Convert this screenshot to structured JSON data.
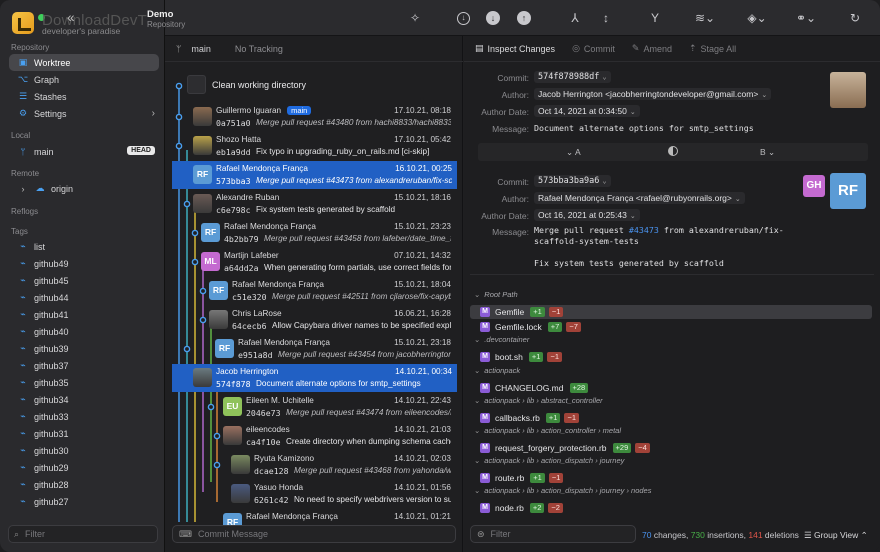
{
  "app": {
    "title": "DownloadDevT",
    "subtitle": "developer's paradise"
  },
  "repo": {
    "title": "Demo",
    "subtitle": "Repository"
  },
  "sidebar": {
    "repository_label": "Repository",
    "repo_items": [
      "Worktree",
      "Graph",
      "Stashes",
      "Settings"
    ],
    "local_label": "Local",
    "local_branch": "main",
    "head_badge": "HEAD",
    "remote_label": "Remote",
    "remote_item": "origin",
    "reflogs_label": "Reflogs",
    "tags_label": "Tags",
    "tags": [
      "list",
      "github49",
      "github45",
      "github44",
      "github41",
      "github40",
      "github39",
      "github37",
      "github35",
      "github34",
      "github33",
      "github31",
      "github30",
      "github29",
      "github28",
      "github27"
    ],
    "filter_placeholder": "Filter"
  },
  "branch_bar": {
    "branch": "main",
    "tracking": "No Tracking"
  },
  "worktree": {
    "clean": "Clean working directory"
  },
  "commits": [
    {
      "author": "Guillermo Iguaran",
      "tag": "main",
      "date": "17.10.21, 08:18",
      "sha": "0a751a0",
      "msg": "Merge pull request #43480 from hachi8833/hachi8833-...",
      "merge": true,
      "avatar": "photo",
      "color": "#8a6a50"
    },
    {
      "author": "Shozo Hatta",
      "date": "17.10.21, 05:42",
      "sha": "eb1a9dd",
      "msg": "Fix typo in upgrading_ruby_on_rails.md [ci-skip]",
      "merge": false,
      "avatar": "photo",
      "color": "#b9a24a"
    },
    {
      "author": "Rafael Mendonça França",
      "date": "16.10.21, 00:25",
      "sha": "573bba3",
      "msg": "Merge pull request #43473 from alexandreruban/fix-sca...",
      "merge": true,
      "avatar": "RF",
      "color": "#5b9bd5",
      "selected": true
    },
    {
      "author": "Alexandre Ruban",
      "date": "15.10.21, 18:16",
      "sha": "c6e798c",
      "msg": "Fix system tests generated by scaffold",
      "merge": false,
      "avatar": "photo",
      "color": "#6a5a55"
    },
    {
      "author": "Rafael Mendonça França",
      "date": "15.10.21, 23:23",
      "sha": "4b2bb79",
      "msg": "Merge pull request #43458 from lafeber/date_time_fi...",
      "merge": true,
      "avatar": "RF",
      "color": "#5b9bd5"
    },
    {
      "author": "Martijn Lafeber",
      "date": "07.10.21, 14:32",
      "sha": "a64dd2a",
      "msg": "When generating form partials, use correct fields for d...",
      "merge": false,
      "avatar": "ML",
      "color": "#c46ad0"
    },
    {
      "author": "Rafael Mendonça França",
      "date": "15.10.21, 18:04",
      "sha": "c51e320",
      "msg": "Merge pull request #42511 from cjlarose/fix-capybar...",
      "merge": true,
      "avatar": "RF",
      "color": "#5b9bd5"
    },
    {
      "author": "Chris LaRose",
      "date": "16.06.21, 16:28",
      "sha": "64cecb6",
      "msg": "Allow Capybara driver names to be specified explicitly",
      "merge": false,
      "avatar": "photo",
      "color": "#777"
    },
    {
      "author": "Rafael Mendonça França",
      "date": "15.10.21, 23:18",
      "sha": "e951a8d",
      "msg": "Merge pull request #43454 from jacobherrington/a...",
      "merge": true,
      "avatar": "RF",
      "color": "#5b9bd5"
    },
    {
      "author": "Jacob Herrington",
      "date": "14.10.21, 00:34",
      "sha": "574f878",
      "msg": "Document alternate options for smtp_settings",
      "merge": false,
      "avatar": "photo",
      "color": "#6a7a80",
      "selected": true
    },
    {
      "author": "Eileen M. Uchitelle",
      "date": "14.10.21, 22:43",
      "sha": "2046e73",
      "msg": "Merge pull request #43474 from eileencodes/ma...",
      "merge": true,
      "avatar": "EU",
      "color": "#8fc25a"
    },
    {
      "author": "eileencodes",
      "date": "14.10.21, 21:03",
      "sha": "ca4f10e",
      "msg": "Create directory when dumping schema cache",
      "merge": false,
      "avatar": "photo",
      "color": "#9a7060"
    },
    {
      "author": "Ryuta Kamizono",
      "date": "14.10.21, 02:03",
      "sha": "dcae128",
      "msg": "Merge pull request #43468 from yahonda/webdri...",
      "merge": true,
      "avatar": "photo",
      "color": "#7a8a60"
    },
    {
      "author": "Yasuo Honda",
      "date": "14.10.21, 01:56",
      "sha": "6261c42",
      "msg": "No need to specify webdrivers version to support sel...",
      "merge": false,
      "avatar": "photo",
      "color": "#4a5a80"
    },
    {
      "author": "Rafael Mendonça França",
      "date": "14.10.21, 01:21",
      "sha": "",
      "msg": "",
      "merge": true,
      "avatar": "RF",
      "color": "#5b9bd5"
    }
  ],
  "commit_message_placeholder": "Commit Message",
  "detail_tabs": [
    "Inspect Changes",
    "Commit",
    "Amend",
    "Stage All"
  ],
  "detail": {
    "labels": {
      "commit": "Commit:",
      "author": "Author:",
      "date": "Author Date:",
      "message": "Message:"
    },
    "a": {
      "commit": "574f878988df",
      "author": "Jacob Herrington <jacobherringtondeveloper@gmail.com>",
      "date": "Oct 14, 2021 at 0:34:50",
      "message": "Document alternate options for smtp_settings"
    },
    "ab": {
      "a": "A",
      "b": "B"
    },
    "b": {
      "commit": "573bba3ba9a6",
      "author": "Rafael Mendonça França <rafael@rubyonrails.org>",
      "date": "Oct 16, 2021 at 0:25:43",
      "message_line1_pre": "Merge pull request ",
      "message_link": "#43473",
      "message_line1_post": " from alexandreruban/fix-",
      "message_line2": "scaffold-system-tests",
      "message_line3": "Fix system tests generated by scaffold",
      "avatar_small": "GH",
      "avatar_big": "RF"
    }
  },
  "files": [
    {
      "group": "Root Path"
    },
    {
      "name": "Gemfile",
      "plus": "+1",
      "minus": "−1",
      "selected": true
    },
    {
      "name": "Gemfile.lock",
      "plus": "+7",
      "minus": "−7"
    },
    {
      "group": ".devcontainer"
    },
    {
      "name": "boot.sh",
      "plus": "+1",
      "minus": "−1"
    },
    {
      "group": "actionpack"
    },
    {
      "name": "CHANGELOG.md",
      "plus": "+28",
      "minus": ""
    },
    {
      "group": "actionpack › lib › abstract_controller"
    },
    {
      "name": "callbacks.rb",
      "plus": "+1",
      "minus": "−1"
    },
    {
      "group": "actionpack › lib › action_controller › metal"
    },
    {
      "name": "request_forgery_protection.rb",
      "plus": "+29",
      "minus": "−4"
    },
    {
      "group": "actionpack › lib › action_dispatch › journey"
    },
    {
      "name": "route.rb",
      "plus": "+1",
      "minus": "−1"
    },
    {
      "group": "actionpack › lib › action_dispatch › journey › nodes"
    },
    {
      "name": "node.rb",
      "plus": "+2",
      "minus": "−2"
    }
  ],
  "file_filter_placeholder": "Filter",
  "stats": {
    "changes": "70",
    "changes_label": " changes, ",
    "insertions": "730",
    "insertions_label": " insertions, ",
    "deletions": "141",
    "deletions_label": " deletions"
  },
  "group_view": "Group View ⌃"
}
